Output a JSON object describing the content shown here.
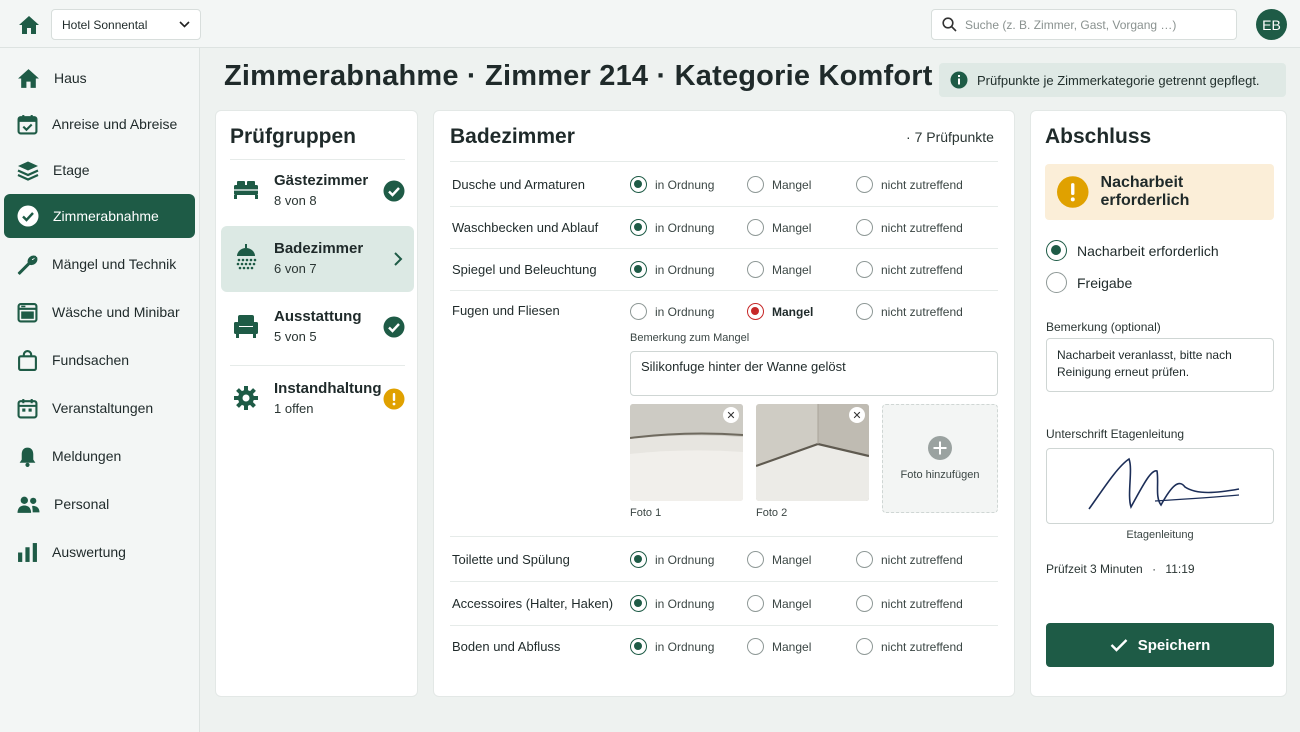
{
  "topbar": {
    "hotel": "Hotel Sonnental",
    "search_placeholder": "Suche (z. B. Zimmer, Gast, Vorgang …)",
    "avatar": "EB"
  },
  "sidebar": {
    "items": [
      {
        "label": "Haus",
        "icon": "house-icon"
      },
      {
        "label": "Anreise und Abreise",
        "icon": "calendar-icon"
      },
      {
        "label": "Etage",
        "icon": "layers-icon"
      },
      {
        "label": "Zimmerabnahme",
        "icon": "check-circle-icon",
        "active": true
      },
      {
        "label": "Mängel und Technik",
        "icon": "wrench-icon"
      },
      {
        "label": "Wäsche und Minibar",
        "icon": "laundry-icon"
      },
      {
        "label": "Fundsachen",
        "icon": "bag-icon"
      },
      {
        "label": "Veranstaltungen",
        "icon": "calendar-event-icon"
      },
      {
        "label": "Meldungen",
        "icon": "bell-icon"
      },
      {
        "label": "Personal",
        "icon": "people-icon"
      },
      {
        "label": "Auswertung",
        "icon": "bar-chart-icon"
      }
    ]
  },
  "header": {
    "title": "Zimmerabnahme · Zimmer 214 · Kategorie Komfort",
    "info": "Prüfpunkte je Zimmerkategorie getrennt gepflegt."
  },
  "groups": {
    "title": "Prüfgruppen",
    "items": [
      {
        "name": "Gästezimmer",
        "count": "8 von 8",
        "icon": "bed-icon",
        "status": "done"
      },
      {
        "name": "Badezimmer",
        "count": "6 von 7",
        "icon": "shower-icon",
        "status": "current"
      },
      {
        "name": "Ausstattung",
        "count": "5 von 5",
        "icon": "armchair-icon",
        "status": "done"
      },
      {
        "name": "Instandhaltung",
        "count": "1 offen",
        "icon": "gear-icon",
        "status": "warning"
      }
    ]
  },
  "checklist": {
    "title": "Badezimmer",
    "count": "7 Prüfpunkte",
    "options": {
      "ok": "in Ordnung",
      "defect": "Mangel",
      "na": "nicht zutreffend"
    },
    "rows": [
      {
        "label": "Dusche und Armaturen",
        "value": "ok"
      },
      {
        "label": "Waschbecken und Ablauf",
        "value": "ok"
      },
      {
        "label": "Spiegel und Beleuchtung",
        "value": "ok"
      },
      {
        "label": "Fugen und Fliesen",
        "value": "defect"
      },
      {
        "label": "Toilette und Spülung",
        "value": "ok"
      },
      {
        "label": "Accessoires (Halter, Haken)",
        "value": "ok"
      },
      {
        "label": "Boden und Abfluss",
        "value": "ok"
      }
    ],
    "defect": {
      "comment_label": "Bemerkung zum Mangel",
      "comment": "Silikonfuge hinter der Wanne gelöst",
      "photos": [
        "Foto 1",
        "Foto 2"
      ],
      "add_photo": "Foto hinzufügen"
    }
  },
  "conclusion": {
    "title": "Abschluss",
    "alert": "Nacharbeit erforderlich",
    "options": [
      "Nacharbeit erforderlich",
      "Freigabe"
    ],
    "selected": 0,
    "remark_label": "Bemerkung (optional)",
    "remark": "Nacharbeit veranlasst, bitte nach Reinigung erneut prüfen.",
    "signature_label": "Unterschrift Etagenleitung",
    "signature_caption": "Etagenleitung",
    "check_time": "Prüfzeit 3 Minuten",
    "time": "11:19",
    "save": "Speichern"
  },
  "colors": {
    "accent": "#1e5b46",
    "defect": "#c62828",
    "warning": "#e0a100",
    "selected_bg": "#dce9e4"
  }
}
